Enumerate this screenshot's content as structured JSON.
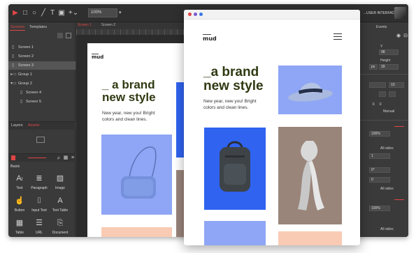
{
  "toolbar": {
    "zoom": "100%",
    "ui_label": "...USER INTERFACE ⌄"
  },
  "left_panel": {
    "tabs": [
      "Screens",
      "Templates"
    ],
    "screens": [
      {
        "label": "Screen 1"
      },
      {
        "label": "Screen 2"
      },
      {
        "label": "Screen 3"
      },
      {
        "label": "Group 1"
      },
      {
        "label": "Group 2"
      },
      {
        "label": "Screen 4"
      },
      {
        "label": "Screen 5"
      }
    ],
    "section_tabs": [
      "Layers",
      "Assets"
    ],
    "components_header": "Basic",
    "components": [
      {
        "label": "Text",
        "icon": "text-icon"
      },
      {
        "label": "Paragraph",
        "icon": "paragraph-icon"
      },
      {
        "label": "Image",
        "icon": "image-icon"
      },
      {
        "label": "Button",
        "icon": "button-icon"
      },
      {
        "label": "Input Text",
        "icon": "input-text-icon"
      },
      {
        "label": "Text Table",
        "icon": "text-table-icon"
      },
      {
        "label": "Table",
        "icon": "table-icon"
      },
      {
        "label": "URL",
        "icon": "url-icon"
      },
      {
        "label": "Document",
        "icon": "document-icon"
      }
    ]
  },
  "canvas": {
    "tabs": [
      "Screen 1",
      "Screen 2"
    ]
  },
  "right_panel": {
    "tab": "Events",
    "y_label": "Y",
    "y_value": "98",
    "height_label": "Height",
    "height_value": "39",
    "unit": "px",
    "font_size": "10",
    "manual_label": "Manual",
    "opacity": "100%",
    "opacity_2": "100%",
    "all_sides": "All sides",
    "value_1": "1",
    "angle": "0°",
    "value_0": "0"
  },
  "design": {
    "logo": "mud",
    "headline": [
      "_ a brand",
      "new style"
    ],
    "subtext": [
      "New year, new you! Bright",
      "colors and clean lines."
    ]
  },
  "phone": {
    "logo": "mud",
    "headline": [
      "_a brand",
      "new style"
    ],
    "subtext": [
      "New year, new you! Bright",
      "colors and clean lines."
    ]
  },
  "colors": {
    "accent": "#e04545",
    "blue_card": "#2f63f0",
    "light_blue_card": "#8ea6f5",
    "taupe_card": "#9a857b",
    "peach_card": "#f9cbb4",
    "headline": "#2f3a12"
  }
}
